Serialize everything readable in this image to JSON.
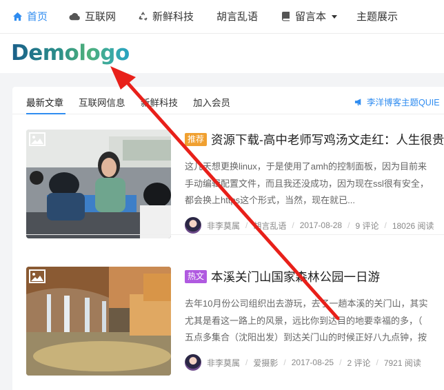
{
  "nav": {
    "home": "首页",
    "internet": "互联网",
    "tech": "新鲜科技",
    "hu": "胡言乱语",
    "msg": "留言本",
    "theme": "主题展示"
  },
  "logo": {
    "text": "Demologo"
  },
  "tabs": [
    "最新文章",
    "互联网信息",
    "新鲜科技",
    "加入会员"
  ],
  "announcement": "李洋博客主题QUIE",
  "articles": [
    {
      "badge": "推荐",
      "title": "资源下载-高中老师写鸡汤文走红：人生很贵",
      "excerpt": [
        "这几天想更换linux，于是使用了amh的控制面板，因为目前来",
        "手动编辑配置文件，而且我还没成功，因为现在ssl很有安全，",
        "都会换上https这个形式，当然，现在就已..."
      ],
      "author": "非李莫属",
      "category": "胡言乱语",
      "date": "2017-08-28",
      "comments": "9 评论",
      "views": "18026 阅读"
    },
    {
      "badge": "热文",
      "title": "本溪关门山国家森林公园一日游",
      "excerpt": [
        "去年10月份公司组织出去游玩，去了一趟本溪的关门山，其实",
        "尤其是看这一路上的风景，远比你到达目的地要幸福的多，（",
        "五点多集合（沈阳出发）到达关门山的时候正好八九点钟，按"
      ],
      "author": "非李莫属",
      "category": "爱摄影",
      "date": "2017-08-25",
      "comments": "2 评论",
      "views": "7921 阅读"
    }
  ],
  "colors": {
    "accent": "#2f8cf0",
    "badge_recommend": "#f0a030",
    "badge_hot": "#b05ae0",
    "arrow": "#e8201a"
  }
}
